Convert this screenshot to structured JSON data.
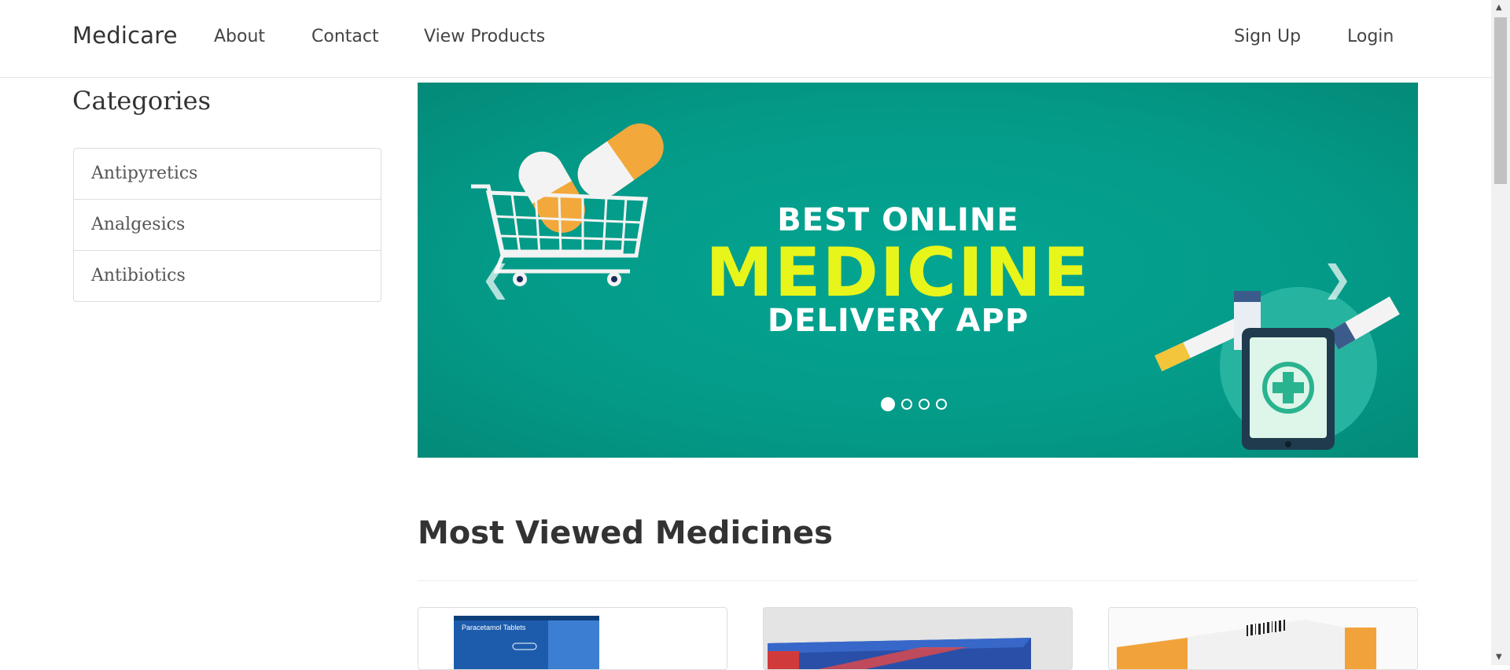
{
  "navbar": {
    "brand": "Medicare",
    "links": [
      "About",
      "Contact",
      "View Products"
    ],
    "right_links": [
      "Sign Up",
      "Login"
    ]
  },
  "sidebar": {
    "title": "Categories",
    "items": [
      "Antipyretics",
      "Analgesics",
      "Antibiotics"
    ]
  },
  "carousel": {
    "line1": "BEST ONLINE",
    "line2": "MEDICINE",
    "line3": "DELIVERY APP",
    "slide_count": 4,
    "active_index": 0
  },
  "section": {
    "title": "Most Viewed Medicines"
  },
  "products": [
    {
      "box_label": "Paracetamol Tablets"
    },
    {
      "box_label": ""
    },
    {
      "box_label": ""
    }
  ],
  "colors": {
    "carousel_bg": "#049a88",
    "headline_yellow": "#e8f51a"
  }
}
